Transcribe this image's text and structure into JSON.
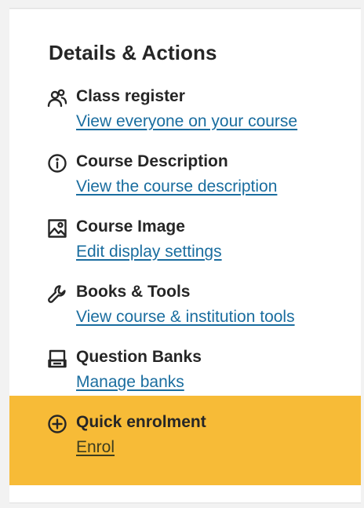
{
  "panel": {
    "title": "Details & Actions",
    "items": [
      {
        "label": "Class register",
        "link": "View everyone on your course",
        "icon": "people-icon"
      },
      {
        "label": "Course Description",
        "link": "View the course description",
        "icon": "info-icon"
      },
      {
        "label": "Course Image",
        "link": "Edit display settings",
        "icon": "image-icon"
      },
      {
        "label": "Books & Tools",
        "link": "View course & institution tools",
        "icon": "wrench-icon"
      },
      {
        "label": "Question Banks",
        "link": "Manage banks",
        "icon": "question-bank-icon"
      },
      {
        "label": "Quick enrolment",
        "link": "Enrol",
        "icon": "plus-circle-icon",
        "highlighted": true
      }
    ]
  },
  "colors": {
    "link": "#1a6d9f",
    "highlight": "#f7bb37",
    "text": "#262626"
  }
}
